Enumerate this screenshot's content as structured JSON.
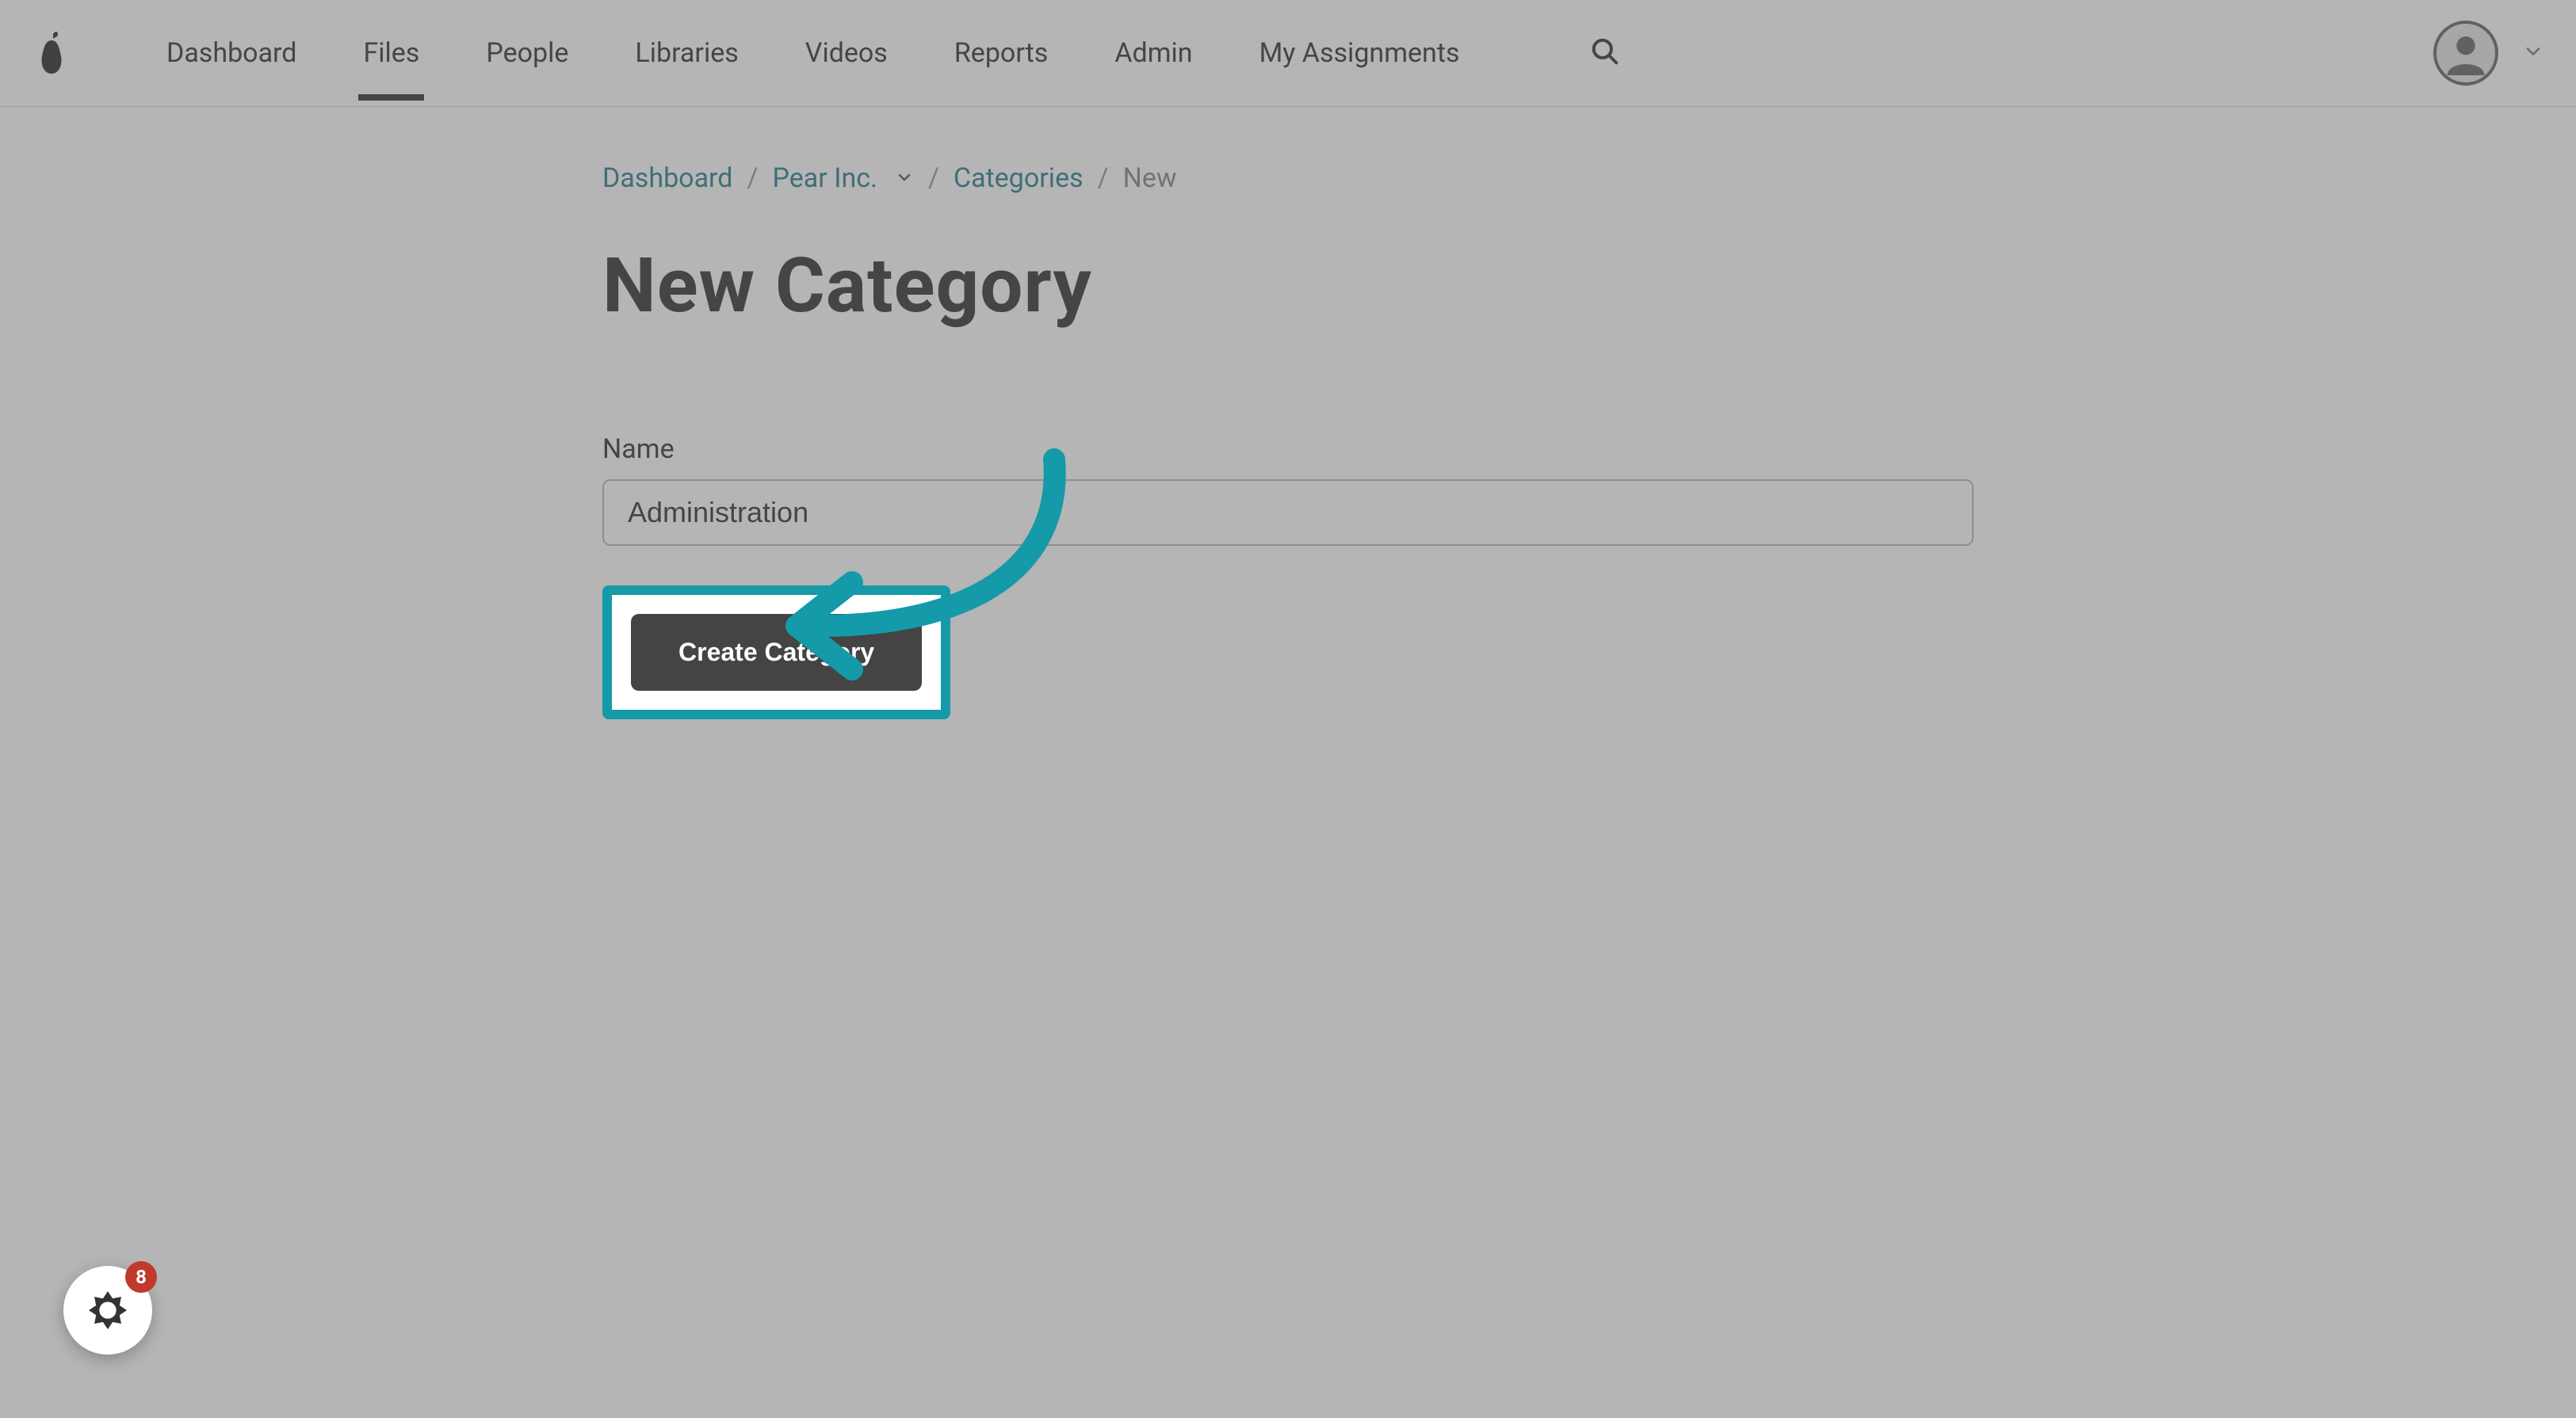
{
  "nav": {
    "items": [
      "Dashboard",
      "Files",
      "People",
      "Libraries",
      "Videos",
      "Reports",
      "Admin",
      "My Assignments"
    ],
    "active_index": 1
  },
  "breadcrumb": {
    "items": [
      {
        "label": "Dashboard",
        "link": true,
        "dropdown": false
      },
      {
        "label": "Pear Inc.",
        "link": true,
        "dropdown": true
      },
      {
        "label": "Categories",
        "link": true,
        "dropdown": false
      },
      {
        "label": "New",
        "link": false,
        "dropdown": false
      }
    ]
  },
  "page": {
    "title": "New Category"
  },
  "form": {
    "name_label": "Name",
    "name_value": "Administration",
    "submit_label": "Create Category"
  },
  "chat": {
    "badge_count": "8"
  },
  "colors": {
    "accent": "#149aa8",
    "link": "#2a7f8f",
    "button_bg": "#444444",
    "badge_bg": "#c0392b"
  }
}
